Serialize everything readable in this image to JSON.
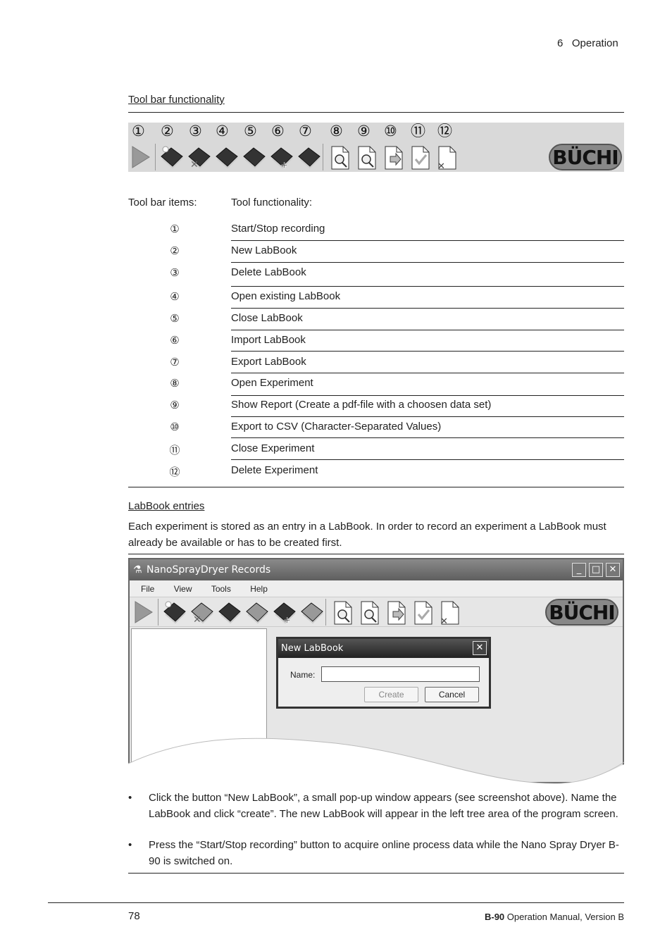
{
  "header": {
    "chapter": "6",
    "section": "Operation"
  },
  "toolbar_section": {
    "heading": "Tool bar functionality",
    "numbers": [
      "①",
      "②",
      "③",
      "④",
      "⑤",
      "⑥",
      "⑦",
      "⑧",
      "⑨",
      "⑩",
      "⑪",
      "⑫"
    ],
    "icons": [
      "play-icon",
      "new-labbook-icon",
      "delete-labbook-icon",
      "open-labbook-icon",
      "close-labbook-icon",
      "import-labbook-icon",
      "export-labbook-icon",
      "open-experiment-icon",
      "show-report-icon",
      "export-csv-icon",
      "close-experiment-icon",
      "delete-experiment-icon"
    ],
    "logo": "BÜCHI"
  },
  "table": {
    "col1": "Tool bar items:",
    "col2": "Tool functionality:",
    "rows": [
      {
        "num": "①",
        "text": "Start/Stop recording"
      },
      {
        "num": "②",
        "text": "New LabBook"
      },
      {
        "num": "③",
        "text": "Delete LabBook"
      },
      {
        "num": "④",
        "text": "Open existing LabBook"
      },
      {
        "num": "⑤",
        "text": "Close LabBook"
      },
      {
        "num": "⑥",
        "text": "Import LabBook"
      },
      {
        "num": "⑦",
        "text": "Export LabBook"
      },
      {
        "num": "⑧",
        "text": "Open Experiment"
      },
      {
        "num": "⑨",
        "text": "Show Report (Create a pdf-file with a choosen data set)"
      },
      {
        "num": "⑩",
        "text": "Export to CSV (Character-Separated Values)"
      },
      {
        "num": "⑪",
        "text": "Close Experiment"
      },
      {
        "num": "⑫",
        "text": "Delete Experiment"
      }
    ]
  },
  "labbook": {
    "heading": "LabBook entries",
    "intro": "Each experiment is stored as an entry in a LabBook. In order to record an experiment a LabBook must already be available or has to be created first."
  },
  "window": {
    "title": "NanoSprayDryer Records",
    "menu": [
      "File",
      "View",
      "Tools",
      "Help"
    ],
    "dialog": {
      "title": "New LabBook",
      "name_label": "Name:",
      "name_value": "",
      "create": "Create",
      "cancel": "Cancel"
    }
  },
  "bullets": [
    "Click the button “New LabBook”, a small pop-up window appears (see screenshot above). Name the LabBook and click “create”. The new LabBook will appear in the left tree area of the program screen.",
    "Press the “Start/Stop recording” button to acquire online process data while the Nano Spray Dryer B-90 is switched on."
  ],
  "footer": {
    "page": "78",
    "product": "B-90",
    "doc": " Operation Manual, Version B"
  }
}
